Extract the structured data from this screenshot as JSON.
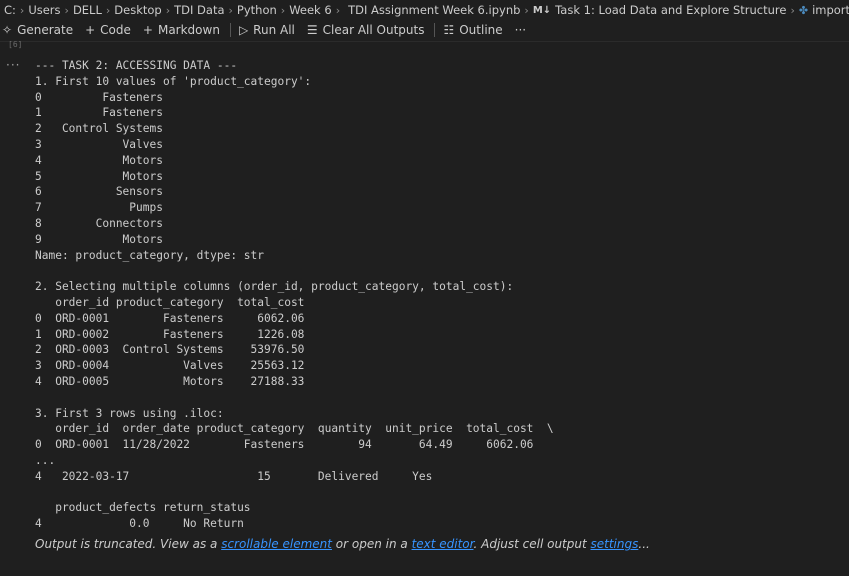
{
  "breadcrumb": {
    "drive": "C:",
    "users": "Users",
    "user": "DELL",
    "desktop": "Desktop",
    "folder1": "TDI Data",
    "folder2": "Python",
    "folder3": "Week 6",
    "file": "TDI Assignment Week 6.ipynb",
    "md_prefix": "M↓",
    "section": "Task 1: Load Data and Explore Structure",
    "cell": "import pandas as pd"
  },
  "toolbar": {
    "generate": "Generate",
    "code": "Code",
    "markdown": "Markdown",
    "run_all": "Run All",
    "clear_all": "Clear All Outputs",
    "outline": "Outline",
    "more": "···"
  },
  "cell": {
    "exec_label": "[6]"
  },
  "output": {
    "menu": "···",
    "lines": [
      "--- TASK 2: ACCESSING DATA ---",
      "1. First 10 values of 'product_category':",
      "0         Fasteners",
      "1         Fasteners",
      "2   Control Systems",
      "3            Valves",
      "4            Motors",
      "5            Motors",
      "6           Sensors",
      "7             Pumps",
      "8        Connectors",
      "9            Motors",
      "Name: product_category, dtype: str",
      "",
      "2. Selecting multiple columns (order_id, product_category, total_cost):",
      "   order_id product_category  total_cost",
      "0  ORD-0001        Fasteners     6062.06",
      "1  ORD-0002        Fasteners     1226.08",
      "2  ORD-0003  Control Systems    53976.50",
      "3  ORD-0004           Valves    25563.12",
      "4  ORD-0005           Motors    27188.33",
      "",
      "3. First 3 rows using .iloc:",
      "   order_id  order_date product_category  quantity  unit_price  total_cost  \\",
      "0  ORD-0001  11/28/2022        Fasteners        94       64.49     6062.06",
      "...",
      "4   2022-03-17                   15       Delivered     Yes",
      "",
      "   product_defects return_status",
      "4             0.0     No Return"
    ]
  },
  "truncation": {
    "prefix": "Output is truncated. View as a ",
    "link1": "scrollable element",
    "middle": " or open in a ",
    "link2": "text editor",
    "suffix": ". Adjust cell output ",
    "link3": "settings",
    "end": "..."
  }
}
